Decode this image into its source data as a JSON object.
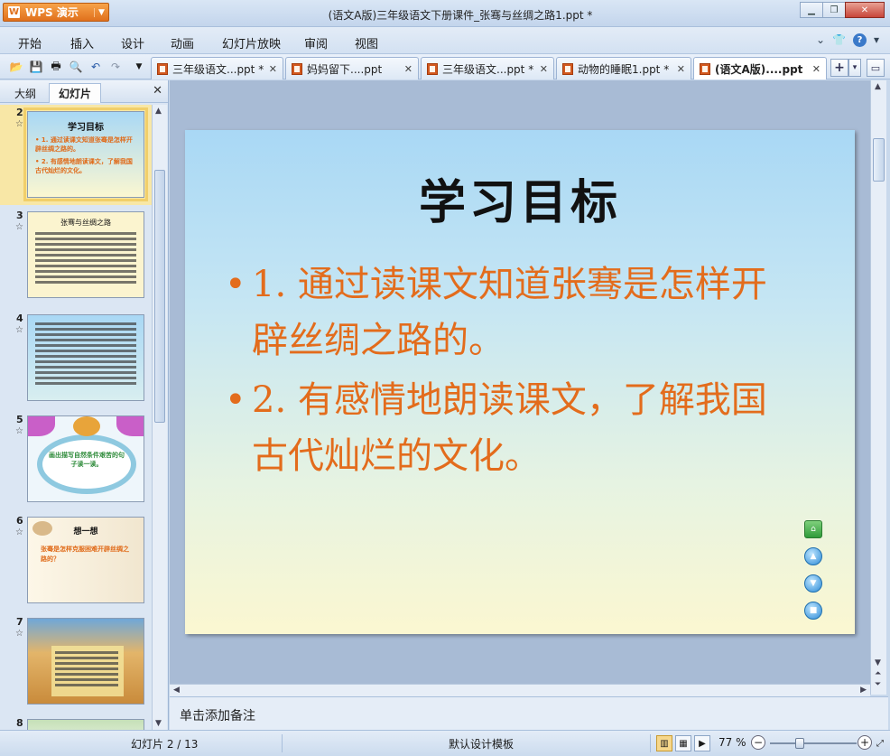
{
  "app": {
    "name": "WPS 演示",
    "window_title": "(语文A版)三年级语文下册课件_张骞与丝绸之路1.ppt *"
  },
  "menu": [
    "开始",
    "插入",
    "设计",
    "动画",
    "幻灯片放映",
    "审阅",
    "视图"
  ],
  "tabs": [
    {
      "label": "三年级语文...ppt *",
      "active": false
    },
    {
      "label": "妈妈留下....ppt",
      "active": false
    },
    {
      "label": "三年级语文...ppt *",
      "active": false
    },
    {
      "label": "动物的睡眠1.ppt *",
      "active": false
    },
    {
      "label": "(语文A版)....ppt *",
      "active": true
    }
  ],
  "left_panel": {
    "tabs": [
      "大纲",
      "幻灯片"
    ],
    "active_tab": "幻灯片",
    "thumbnails": [
      {
        "num": "2",
        "title": "学习目标",
        "lines": [
          "• 1. 通过读课文知道张骞是怎样开辟丝绸之路的。",
          "• 2. 有感情地朗读课文，了解我国古代灿烂的文化。"
        ]
      },
      {
        "num": "3",
        "title": "张骞与丝绸之路"
      },
      {
        "num": "4"
      },
      {
        "num": "5",
        "caption": "画出描写自然条件艰苦的句子读一读。"
      },
      {
        "num": "6",
        "title": "想一想",
        "caption": "张骞是怎样克服困难开辟丝绸之路的？"
      },
      {
        "num": "7"
      },
      {
        "num": "8"
      }
    ]
  },
  "slide": {
    "title": "学习目标",
    "bullets": [
      "1. 通过读课文知道张骞是怎样开辟丝绸之路的。",
      "2. 有感情地朗读课文，了解我国古代灿烂的文化。"
    ]
  },
  "notes_placeholder": "单击添加备注",
  "status": {
    "slide_info": "幻灯片 2 / 13",
    "template": "默认设计模板",
    "zoom": "77 %"
  },
  "colors": {
    "accent_orange": "#e36c1c",
    "title_dark": "#111111"
  }
}
